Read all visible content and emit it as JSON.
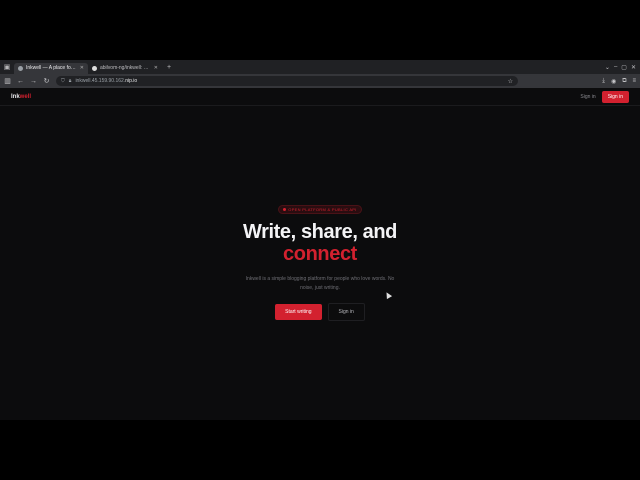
{
  "browser": {
    "tabs": [
      {
        "title": "Inkwell — A place for your tho",
        "active": true
      },
      {
        "title": "abilvom-ng/inkwell: Simple",
        "active": false
      }
    ],
    "url": {
      "prefix": "inkwell.45.159.90.162.",
      "host": "nip.io"
    }
  },
  "site": {
    "logo_main": "Ink",
    "logo_accent": "well",
    "nav": {
      "sign_in_link": "Sign in",
      "sign_in_button": "Sign in"
    },
    "hero": {
      "badge": "OPEN PLATFORM & PUBLIC API",
      "headline_line1": "Write, share, and",
      "headline_line2": "connect",
      "lede": "Inkwell is a simple blogging platform for people who love words. No noise, just writing.",
      "primary_cta": "Start writing",
      "secondary_cta": "Sign in"
    }
  },
  "colors": {
    "accent": "#d3212f",
    "background": "#0c0c0d"
  }
}
